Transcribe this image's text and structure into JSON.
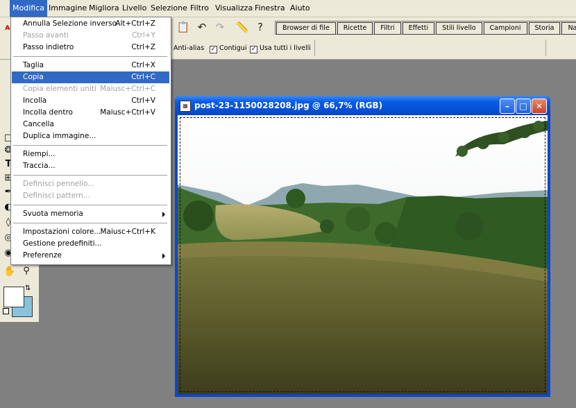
{
  "menubar": {
    "items": [
      {
        "label": "Modifica",
        "active": true
      },
      {
        "label": "Immagine"
      },
      {
        "label": "Migliora"
      },
      {
        "label": "Livello"
      },
      {
        "label": "Selezione"
      },
      {
        "label": "Filtro"
      },
      {
        "label": "Visualizza"
      },
      {
        "label": "Finestra"
      },
      {
        "label": "Aiuto"
      }
    ]
  },
  "palette_well": {
    "tabs": [
      "Browser di file",
      "Ricette",
      "Filtri",
      "Effetti",
      "Stili livello",
      "Campioni",
      "Storia",
      "Navigat"
    ]
  },
  "options": {
    "anti_alias": "Anti-alias",
    "contigui": "Contigui",
    "usa_tutti": "Usa tutti i livelli",
    "contigui_checked": true,
    "usa_tutti_checked": true
  },
  "edit_menu": {
    "items": [
      {
        "label": "Annulla Selezione inverso",
        "shortcut": "Alt+Ctrl+Z"
      },
      {
        "label": "Passo avanti",
        "shortcut": "Ctrl+Y",
        "disabled": true
      },
      {
        "label": "Passo indietro",
        "shortcut": "Ctrl+Z"
      },
      {
        "label": "Taglia",
        "shortcut": "Ctrl+X"
      },
      {
        "label": "Copia",
        "shortcut": "Ctrl+C",
        "highlighted": true
      },
      {
        "label": "Copia elementi uniti",
        "shortcut": "Maiusc+Ctrl+C",
        "disabled": true
      },
      {
        "label": "Incolla",
        "shortcut": "Ctrl+V"
      },
      {
        "label": "Incolla dentro",
        "shortcut": "Maiusc+Ctrl+V"
      },
      {
        "label": "Cancella",
        "shortcut": ""
      },
      {
        "label": "Duplica immagine...",
        "shortcut": ""
      },
      {
        "label": "Riempi...",
        "shortcut": ""
      },
      {
        "label": "Traccia...",
        "shortcut": ""
      },
      {
        "label": "Definisci pennello...",
        "shortcut": "",
        "disabled": true
      },
      {
        "label": "Definisci pattern...",
        "shortcut": "",
        "disabled": true
      },
      {
        "label": "Svuota memoria",
        "shortcut": "",
        "submenu": true
      },
      {
        "label": "Impostazioni colore...",
        "shortcut": "Maiusc+Ctrl+K"
      },
      {
        "label": "Gestione predefiniti...",
        "shortcut": ""
      },
      {
        "label": "Preferenze",
        "shortcut": "",
        "submenu": true
      }
    ]
  },
  "image_window": {
    "title": "post-23-1150028208.jpg @ 66,7% (RGB)"
  },
  "colors": {
    "menu_highlight": "#316ac5",
    "xp_title_blue": "#0550d8",
    "foreground_swatch": "#ffffff",
    "background_swatch": "#87c3dc",
    "workspace": "#808080"
  },
  "icons": [
    "marquee-icon",
    "lasso-icon",
    "type-icon",
    "crop-icon",
    "eyedropper-icon",
    "paint-bucket-icon",
    "hand-icon",
    "zoom-icon",
    "undo-icon",
    "redo-icon",
    "ruler-icon",
    "help-icon",
    "paste-icon",
    "swap-colors-icon"
  ]
}
